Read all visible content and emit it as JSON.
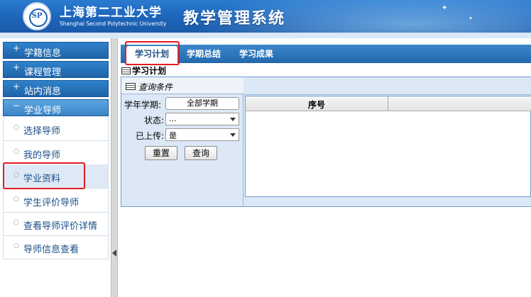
{
  "header": {
    "school_name_cn": "上海第二工业大学",
    "school_name_en": "Shanghai Second Polytechnic University",
    "system_title": "教学管理系统",
    "logo_icon": "university-logo-icon"
  },
  "sidebar": {
    "menus": [
      {
        "label": "学籍信息",
        "marker": "+"
      },
      {
        "label": "课程管理",
        "marker": "+"
      },
      {
        "label": "站内消息",
        "marker": "+"
      },
      {
        "label": "学业导师",
        "marker": "−"
      }
    ],
    "submenu": [
      {
        "label": "选择导师"
      },
      {
        "label": "我的导师"
      },
      {
        "label": "学业资料"
      },
      {
        "label": "学生评价导师"
      },
      {
        "label": "查看导师评价详情"
      },
      {
        "label": "导师信息查看"
      }
    ],
    "selected": "学业资料"
  },
  "tabs": [
    {
      "label": "学习计划",
      "active": true
    },
    {
      "label": "学期总结",
      "active": false
    },
    {
      "label": "学习成果",
      "active": false
    }
  ],
  "section_title": "学习计划",
  "query": {
    "title": "查询条件",
    "term_label": "学年学期:",
    "term_value": "全部学期",
    "status_label": "状态:",
    "status_value": "...",
    "uploaded_label": "已上传:",
    "uploaded_value": "是",
    "reset_label": "重置",
    "search_label": "查询"
  },
  "grid": {
    "columns": [
      "序号"
    ]
  },
  "colors": {
    "header_blue": "#1c64b9",
    "tab_blue": "#2268ad",
    "panel_bg": "#dde8f6",
    "highlight_red": "#e21b22"
  }
}
